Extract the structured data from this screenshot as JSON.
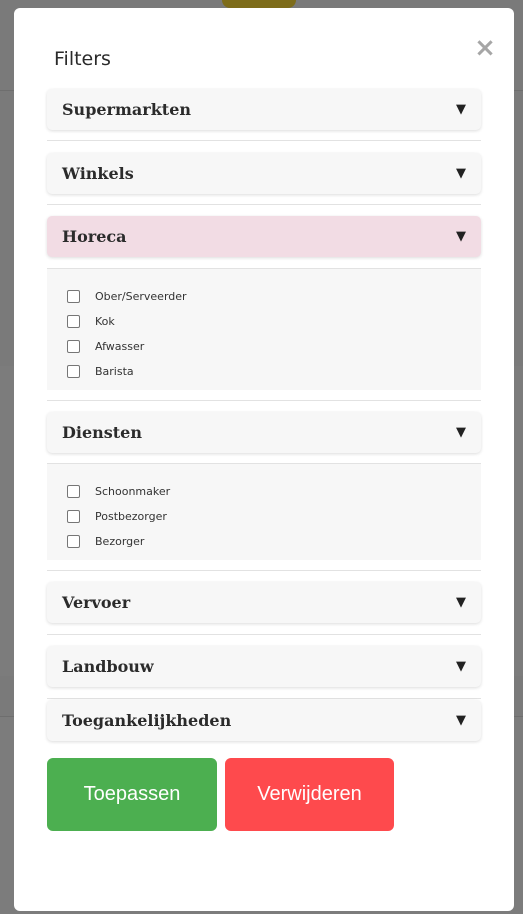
{
  "modal": {
    "title": "Filters",
    "close_glyph": "×"
  },
  "sections": [
    {
      "label": "Supermarkten",
      "expanded": false
    },
    {
      "label": "Winkels",
      "expanded": false
    },
    {
      "label": "Horeca",
      "expanded": true,
      "highlighted": true,
      "options": [
        "Ober/Serveerder",
        "Kok",
        "Afwasser",
        "Barista"
      ]
    },
    {
      "label": "Diensten",
      "expanded": true,
      "options": [
        "Schoonmaker",
        "Postbezorger",
        "Bezorger"
      ]
    },
    {
      "label": "Vervoer",
      "expanded": false
    },
    {
      "label": "Landbouw",
      "expanded": false
    },
    {
      "label": "Toegankelijkheden",
      "expanded": false
    }
  ],
  "arrow_glyph": "▼",
  "buttons": {
    "apply_label": "Toepassen",
    "remove_label": "Verwijderen"
  },
  "colors": {
    "apply": "#4caf50",
    "remove": "#fe4a4d",
    "active_header": "#f2dce4",
    "overlay": "#7a7a7a"
  }
}
